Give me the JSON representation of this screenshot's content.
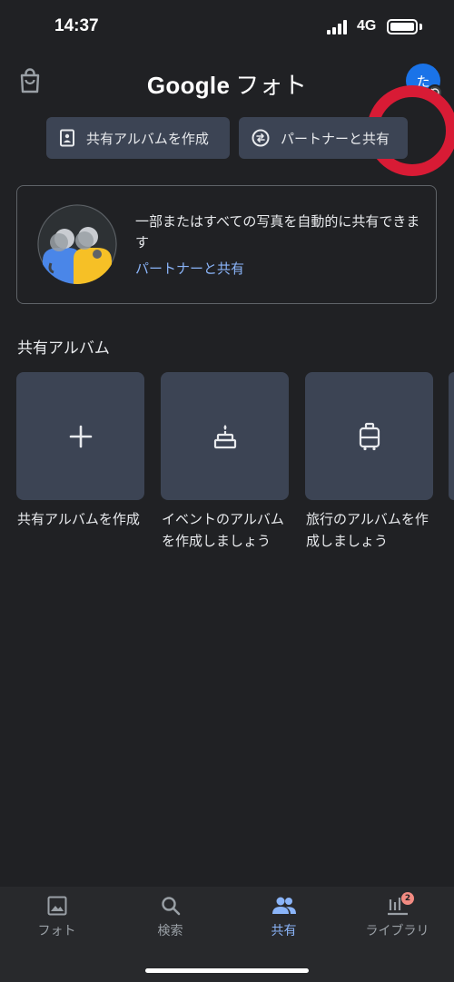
{
  "status_bar": {
    "time": "14:37",
    "network": "4G",
    "signal_bars": 4,
    "battery_level": 0.9
  },
  "header": {
    "logo_google": "Google",
    "logo_photos": "フォト",
    "avatar_initial": "た",
    "left_icon": "shopping-bag-icon"
  },
  "chips": [
    {
      "label": "共有アルバムを作成",
      "icon": "shared-album-icon"
    },
    {
      "label": "パートナーと共有",
      "icon": "partner-share-icon"
    }
  ],
  "share_card": {
    "text": "一部またはすべての写真を自動的に共有できます",
    "link": "パートナーと共有"
  },
  "section": {
    "title": "共有アルバム"
  },
  "albums": [
    {
      "label": "共有アルバムを作成",
      "icon": "plus-icon"
    },
    {
      "label": "イベントのアルバムを作成しましょう",
      "icon": "cake-icon"
    },
    {
      "label": "旅行のアルバムを作成しましょう",
      "icon": "luggage-icon"
    }
  ],
  "bottom_nav": {
    "items": [
      {
        "label": "フォト",
        "icon": "photo-icon",
        "active": false
      },
      {
        "label": "検索",
        "icon": "search-icon",
        "active": false
      },
      {
        "label": "共有",
        "icon": "sharing-people-icon",
        "active": true
      },
      {
        "label": "ライブラリ",
        "icon": "library-icon",
        "active": false
      }
    ],
    "library_badge": "2"
  },
  "colors": {
    "background": "#202124",
    "surface": "#3c4454",
    "accent": "#8ab4f8",
    "highlight_ring": "#d81b35",
    "avatar": "#1a73e8"
  }
}
